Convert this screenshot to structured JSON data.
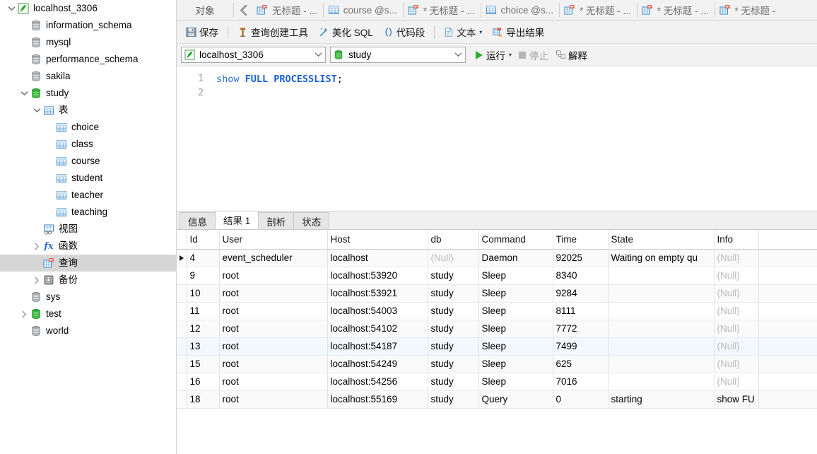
{
  "sidebar": {
    "nodes": [
      {
        "label": "localhost_3306",
        "icon": "connection-icon",
        "depth": 0,
        "twisty": "down",
        "selected": false
      },
      {
        "label": "information_schema",
        "icon": "database-gray-icon",
        "depth": 1,
        "twisty": "none",
        "selected": false
      },
      {
        "label": "mysql",
        "icon": "database-gray-icon",
        "depth": 1,
        "twisty": "none",
        "selected": false
      },
      {
        "label": "performance_schema",
        "icon": "database-gray-icon",
        "depth": 1,
        "twisty": "none",
        "selected": false
      },
      {
        "label": "sakila",
        "icon": "database-gray-icon",
        "depth": 1,
        "twisty": "none",
        "selected": false
      },
      {
        "label": "study",
        "icon": "database-green-icon",
        "depth": 1,
        "twisty": "down",
        "selected": false
      },
      {
        "label": "表",
        "icon": "table-folder-icon",
        "depth": 2,
        "twisty": "down",
        "selected": false
      },
      {
        "label": "choice",
        "icon": "table-icon",
        "depth": 3,
        "twisty": "none",
        "selected": false
      },
      {
        "label": "class",
        "icon": "table-icon",
        "depth": 3,
        "twisty": "none",
        "selected": false
      },
      {
        "label": "course",
        "icon": "table-icon",
        "depth": 3,
        "twisty": "none",
        "selected": false
      },
      {
        "label": "student",
        "icon": "table-icon",
        "depth": 3,
        "twisty": "none",
        "selected": false
      },
      {
        "label": "teacher",
        "icon": "table-icon",
        "depth": 3,
        "twisty": "none",
        "selected": false
      },
      {
        "label": "teaching",
        "icon": "table-icon",
        "depth": 3,
        "twisty": "none",
        "selected": false
      },
      {
        "label": "视图",
        "icon": "view-icon",
        "depth": 2,
        "twisty": "none",
        "selected": false
      },
      {
        "label": "函数",
        "icon": "function-icon",
        "depth": 2,
        "twisty": "right",
        "selected": false
      },
      {
        "label": "查询",
        "icon": "query-icon",
        "depth": 2,
        "twisty": "none",
        "selected": true
      },
      {
        "label": "备份",
        "icon": "backup-icon",
        "depth": 2,
        "twisty": "right",
        "selected": false
      },
      {
        "label": "sys",
        "icon": "database-gray-icon",
        "depth": 1,
        "twisty": "none",
        "selected": false
      },
      {
        "label": "test",
        "icon": "database-green-icon",
        "depth": 1,
        "twisty": "right",
        "selected": false
      },
      {
        "label": "world",
        "icon": "database-gray-icon",
        "depth": 1,
        "twisty": "none",
        "selected": false
      }
    ]
  },
  "tabbar": {
    "objects_label": "对象",
    "back_icon": "chevron-left-icon",
    "tabs": [
      {
        "label": "无标题 - ...",
        "icon": "query-icon",
        "modified": false,
        "active": false
      },
      {
        "label": "course @s...",
        "icon": "table-icon",
        "modified": false,
        "active": false
      },
      {
        "label": "* 无标题 - ...",
        "icon": "query-icon",
        "modified": true,
        "active": false
      },
      {
        "label": "choice @s...",
        "icon": "table-icon",
        "modified": false,
        "active": false
      },
      {
        "label": "* 无标题 - ...",
        "icon": "query-icon",
        "modified": true,
        "active": false
      },
      {
        "label": "* 无标题 - ...",
        "icon": "query-icon",
        "modified": true,
        "active": false
      },
      {
        "label": "* 无标题 -",
        "icon": "query-icon",
        "modified": true,
        "active": true
      }
    ]
  },
  "toolbar": {
    "save_label": "保存",
    "save_icon": "save-floppy-icon",
    "query_builder_label": "查询创建工具",
    "query_builder_icon": "query-builder-icon",
    "beautify_label": "美化 SQL",
    "beautify_icon": "wand-icon",
    "snippet_label": "代码段",
    "snippet_icon": "parens-icon",
    "text_label": "文本",
    "text_icon": "document-icon",
    "text_caret": "▾",
    "export_label": "导出结果",
    "export_icon": "export-grid-icon"
  },
  "connbar": {
    "connection_value": "localhost_3306",
    "connection_icon": "connection-icon",
    "database_value": "study",
    "database_icon": "database-green-icon",
    "dropdown_caret": "⌄",
    "run_label": "运行",
    "run_caret": "▾",
    "stop_label": "停止",
    "explain_label": "解释",
    "explain_icon": "explain-icon"
  },
  "editor": {
    "line_numbers": [
      "1",
      "2"
    ],
    "sql_token_1": "show",
    "sql_token_2": "FULL PROCESSLIST",
    "sql_token_3": ";"
  },
  "result_tabs": [
    {
      "label": "信息",
      "active": false
    },
    {
      "label": "结果 1",
      "active": true
    },
    {
      "label": "剖析",
      "active": false
    },
    {
      "label": "状态",
      "active": false
    }
  ],
  "grid": {
    "columns": [
      "Id",
      "User",
      "Host",
      "db",
      "Command",
      "Time",
      "State",
      "Info"
    ],
    "selected_column": "Id",
    "rows": [
      {
        "marker": "▶",
        "Id": "4",
        "User": "event_scheduler",
        "Host": "localhost",
        "db": "(Null)",
        "Command": "Daemon",
        "Time": "92025",
        "State": "Waiting on empty qu",
        "Info": "(Null)"
      },
      {
        "marker": "",
        "Id": "9",
        "User": "root",
        "Host": "localhost:53920",
        "db": "study",
        "Command": "Sleep",
        "Time": "8340",
        "State": "",
        "Info": "(Null)"
      },
      {
        "marker": "",
        "Id": "10",
        "User": "root",
        "Host": "localhost:53921",
        "db": "study",
        "Command": "Sleep",
        "Time": "9284",
        "State": "",
        "Info": "(Null)"
      },
      {
        "marker": "",
        "Id": "11",
        "User": "root",
        "Host": "localhost:54003",
        "db": "study",
        "Command": "Sleep",
        "Time": "8111",
        "State": "",
        "Info": "(Null)"
      },
      {
        "marker": "",
        "Id": "12",
        "User": "root",
        "Host": "localhost:54102",
        "db": "study",
        "Command": "Sleep",
        "Time": "7772",
        "State": "",
        "Info": "(Null)"
      },
      {
        "marker": "",
        "Id": "13",
        "User": "root",
        "Host": "localhost:54187",
        "db": "study",
        "Command": "Sleep",
        "Time": "7499",
        "State": "",
        "Info": "(Null)"
      },
      {
        "marker": "",
        "Id": "15",
        "User": "root",
        "Host": "localhost:54249",
        "db": "study",
        "Command": "Sleep",
        "Time": "625",
        "State": "",
        "Info": "(Null)"
      },
      {
        "marker": "",
        "Id": "16",
        "User": "root",
        "Host": "localhost:54256",
        "db": "study",
        "Command": "Sleep",
        "Time": "7016",
        "State": "",
        "Info": "(Null)"
      },
      {
        "marker": "",
        "Id": "18",
        "User": "root",
        "Host": "localhost:55169",
        "db": "study",
        "Command": "Query",
        "Time": "0",
        "State": "starting",
        "Info": "show FU"
      }
    ],
    "highlighted_row_index": 5
  },
  "colors": {
    "accent_green": "#27ae37",
    "selection_blue": "#d7e6f7",
    "sidebar_selected": "#d6d6d6",
    "null_gray": "#b9b9b9",
    "sql_keyword": "#1a5fd6"
  }
}
